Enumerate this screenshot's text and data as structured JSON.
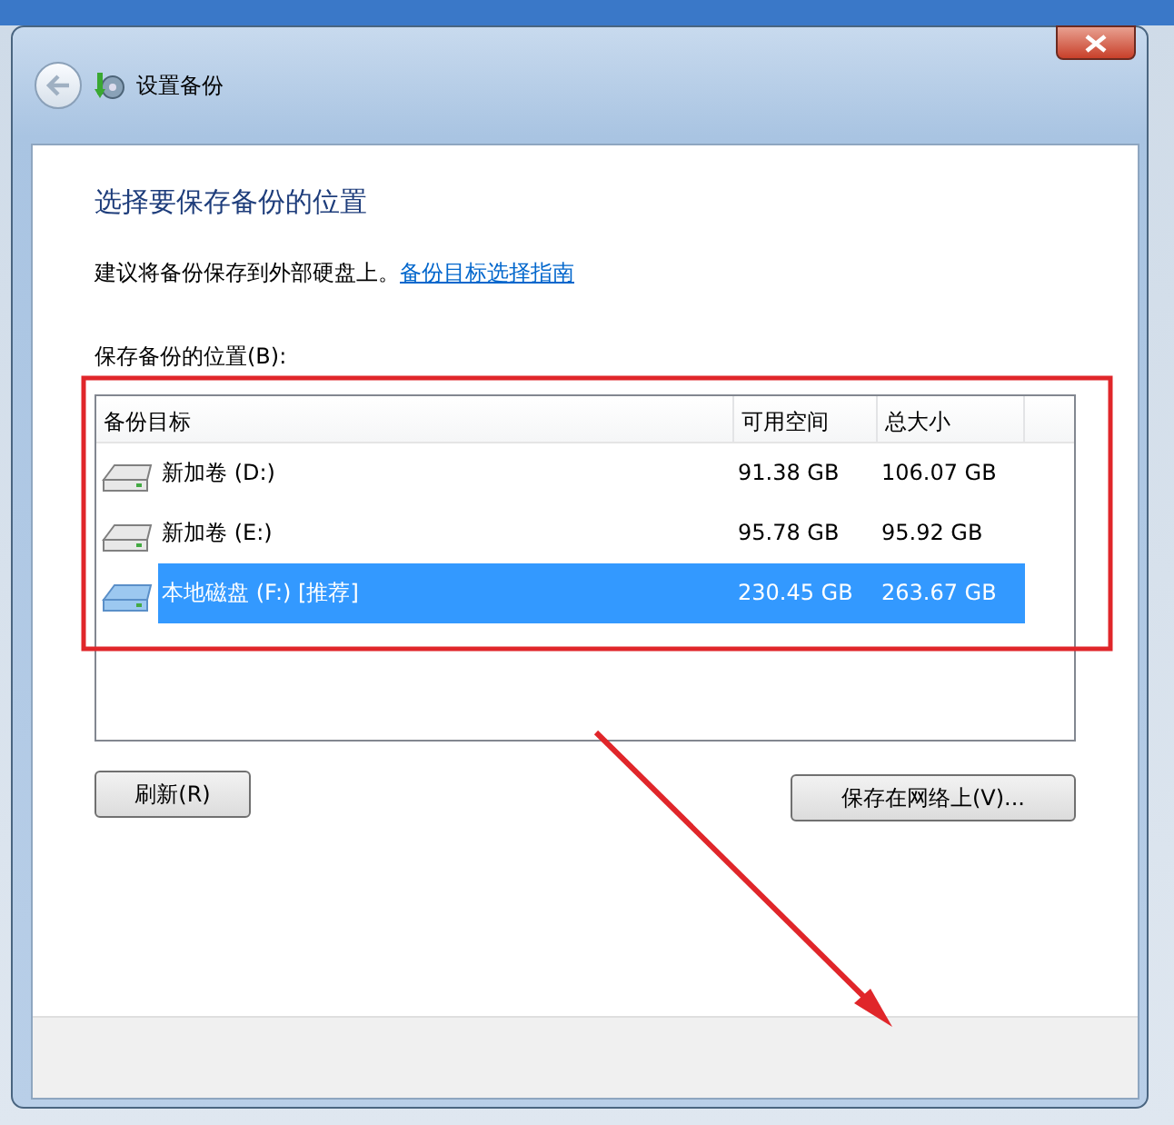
{
  "window": {
    "title": "设置备份"
  },
  "heading": "选择要保存备份的位置",
  "description": {
    "text": "建议将备份保存到外部硬盘上。",
    "link": "备份目标选择指南"
  },
  "list_label": "保存备份的位置(B):",
  "list": {
    "columns": [
      "备份目标",
      "可用空间",
      "总大小"
    ],
    "rows": [
      {
        "name": "新加卷 (D:)",
        "free": "91.38 GB",
        "total": "106.07 GB",
        "selected": false
      },
      {
        "name": "新加卷 (E:)",
        "free": "95.78 GB",
        "total": "95.92 GB",
        "selected": false
      },
      {
        "name": "本地磁盘 (F:) [推荐]",
        "free": "230.45 GB",
        "total": "263.67 GB",
        "selected": true
      }
    ]
  },
  "buttons": [
    "刷新(R)",
    "保存在网络上(V)..."
  ]
}
